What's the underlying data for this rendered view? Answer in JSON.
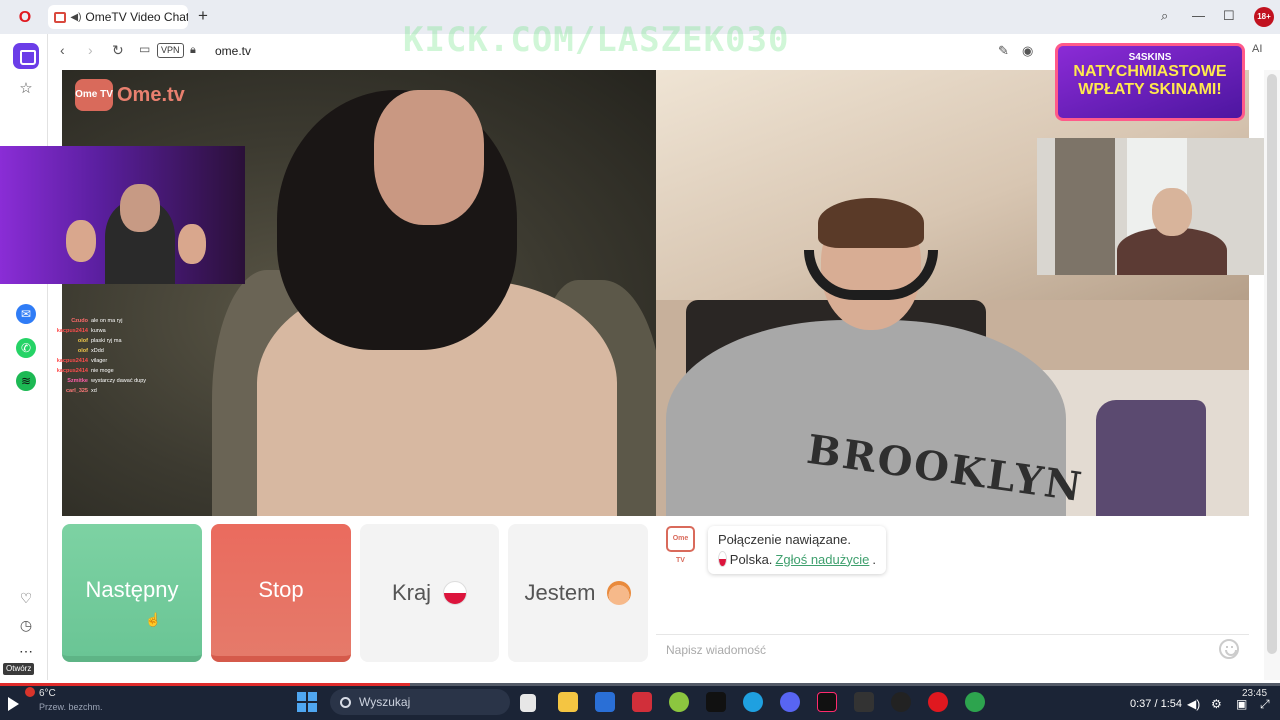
{
  "browser": {
    "tab_title": "OmeTV Video Chat —",
    "url": "ome.tv",
    "vpn_label": "VPN",
    "tooltip": "Otwórz",
    "ai_label": "AI"
  },
  "overlay": {
    "watermark": "KICK.COM/LASZEK030",
    "promo_brand": "S4SKINS",
    "promo_line1": "NATYCHMIASTOWE",
    "promo_line2": "WPŁATY SKINAMI!"
  },
  "ome": {
    "logo_text": "Ome.tv",
    "logo_badge": "Ome TV",
    "brooklyn_print": "BROOKLYN"
  },
  "stream_chat": [
    {
      "user": "Czudo",
      "msg": "ale on ma ryj",
      "color": "#ff6b6b"
    },
    {
      "user": "kacpus2414",
      "msg": "kurwa",
      "color": "#ff4d4d"
    },
    {
      "user": "olof",
      "msg": "plaski ryj ma",
      "color": "#f2c94c"
    },
    {
      "user": "olof",
      "msg": "xDdd",
      "color": "#f2c94c"
    },
    {
      "user": "kacpus2414",
      "msg": "vilager",
      "color": "#ff4d4d"
    },
    {
      "user": "kacpus2414",
      "msg": "nie moge",
      "color": "#ff4d4d"
    },
    {
      "user": "Szmitke",
      "msg": "wystarczy dawać dupy",
      "color": "#ff5ea8"
    },
    {
      "user": "carl_325",
      "msg": "xd",
      "color": "#ff7a7a"
    }
  ],
  "controls": {
    "next": "Następny",
    "stop": "Stop",
    "country": "Kraj",
    "gender": "Jestem"
  },
  "chat": {
    "status": "Połączenie nawiązane.",
    "country": "Polska.",
    "report": "Zgłoś nadużycie",
    "period": ".",
    "placeholder": "Napisz wiadomość"
  },
  "player": {
    "time": "0:37 / 1:54",
    "progress_fraction": 0.32
  },
  "taskbar": {
    "weather_temp": "6°C",
    "weather_desc": "Przew. bezchm.",
    "search_placeholder": "Wyszukaj",
    "clock": "23:45"
  },
  "colors": {
    "next_green": "#7dd2a3",
    "stop_red": "#ea6b5e",
    "link_green": "#3fa06e",
    "opera_red": "#e0181f",
    "sidebar_purple": "#6b3de8"
  }
}
